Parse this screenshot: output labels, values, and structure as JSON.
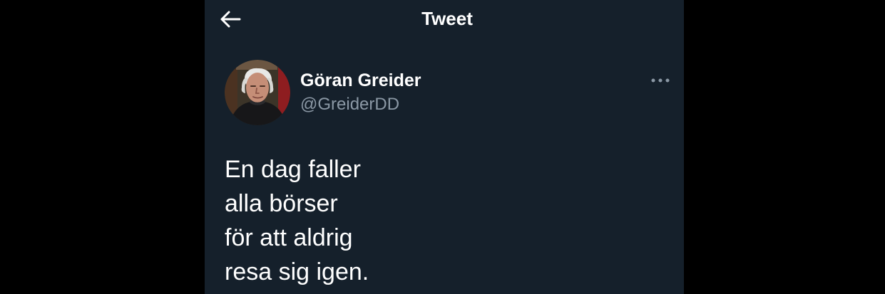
{
  "header": {
    "title": "Tweet",
    "back_icon": "arrow-left-icon"
  },
  "author": {
    "name": "Göran Greider",
    "handle": "@GreiderDD",
    "avatar_icon": "avatar",
    "more_icon": "more-horizontal-icon"
  },
  "tweet": {
    "lines": [
      "En dag faller",
      "alla börser",
      "för att aldrig",
      "resa sig igen."
    ]
  },
  "colors": {
    "background": "#15202b",
    "outer": "#000000",
    "text": "#ffffff",
    "secondary_text": "#8b98a5"
  }
}
